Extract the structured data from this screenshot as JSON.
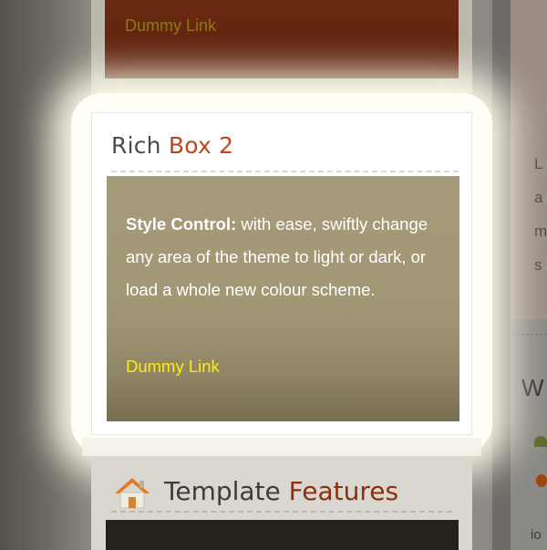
{
  "top_box": {
    "link_label": "Dummy Link"
  },
  "rich_box": {
    "title_part1": "Rich",
    "title_part2": "Box 2",
    "body_strong": "Style Control:",
    "body_text": " with ease, swiftly change any area of the theme to light or dark, or load a whole new colour scheme.",
    "link_label": "Dummy Link"
  },
  "features_box": {
    "title_part1": "Template",
    "title_part2": "Features",
    "icon": "home-icon"
  },
  "right_column": {
    "text_lines": [
      "L",
      "a",
      "m",
      "s"
    ],
    "heading_fragment": "W",
    "bottom_fragment": "io"
  },
  "colors": {
    "accent_red": "#c5431a",
    "link_yellow": "#ffee00",
    "card_body": "#a59b79"
  }
}
